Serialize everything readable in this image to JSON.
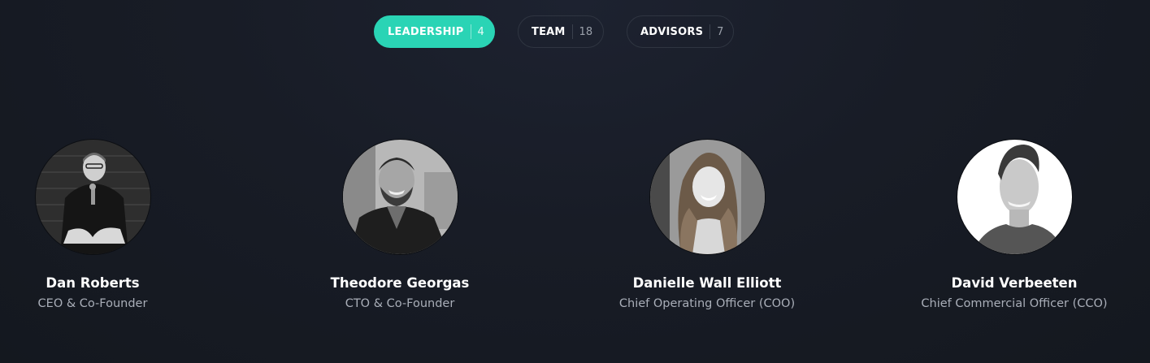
{
  "tabs": [
    {
      "label": "LEADERSHIP",
      "count": "4",
      "active": true
    },
    {
      "label": "TEAM",
      "count": "18",
      "active": false
    },
    {
      "label": "ADVISORS",
      "count": "7",
      "active": false
    }
  ],
  "members": [
    {
      "name": "Dan Roberts",
      "role": "CEO & Co-Founder"
    },
    {
      "name": "Theodore Georgas",
      "role": "CTO & Co-Founder"
    },
    {
      "name": "Danielle Wall Elliott",
      "role": "Chief Operating Officer (COO)"
    },
    {
      "name": "David Verbeeten",
      "role": "Chief Commercial Officer (CCO)"
    }
  ],
  "colors": {
    "background": "#181c26",
    "accent": "#2ad4b5",
    "tab_border": "#2f3541",
    "role_text": "#a9aeb8"
  }
}
